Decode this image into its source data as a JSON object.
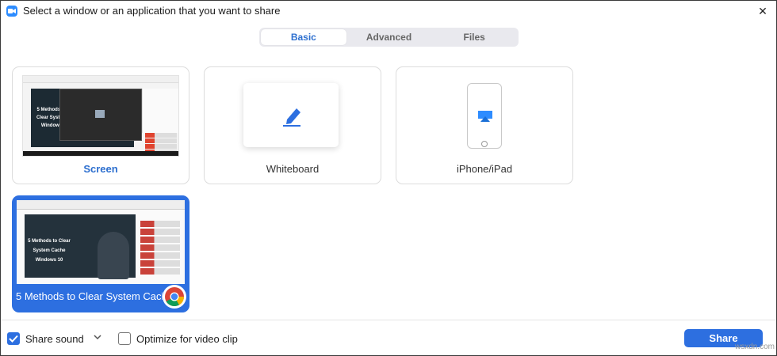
{
  "window": {
    "title": "Select a window or an application that you want to share",
    "close_symbol": "✕"
  },
  "tabs": [
    {
      "label": "Basic",
      "active": true
    },
    {
      "label": "Advanced",
      "active": false
    },
    {
      "label": "Files",
      "active": false
    }
  ],
  "tiles": {
    "screen": {
      "label": "Screen",
      "thumb_text": "5 Methods to Clear System Windows"
    },
    "whiteboard": {
      "label": "Whiteboard",
      "icon": "pencil-icon"
    },
    "iphone": {
      "label": "iPhone/iPad",
      "icon": "airplay-icon"
    },
    "window": {
      "label": "5 Methods to Clear System Cach...",
      "thumb_text": "5 Methods to Clear System Cache Windows 10",
      "app_icon": "chrome-icon"
    }
  },
  "footer": {
    "share_sound_label": "Share sound",
    "share_sound_checked": true,
    "optimize_label": "Optimize for video clip",
    "optimize_checked": false,
    "share_button_label": "Share"
  },
  "watermark": "wsxdn.com",
  "colors": {
    "accent": "#2d6fe0",
    "tab_active_text": "#2d6fcf"
  }
}
